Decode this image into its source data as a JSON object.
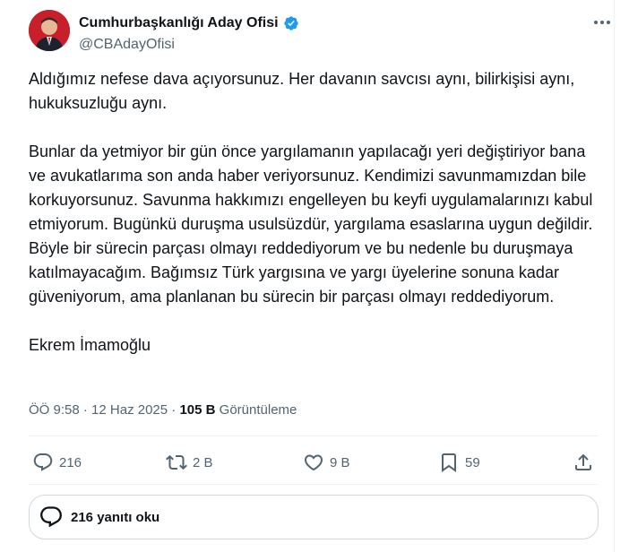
{
  "author": {
    "display_name": "Cumhurbaşkanlığı Aday Ofisi",
    "handle": "@CBAdayOfisi",
    "verified": true,
    "verified_color": "#1d9bf0"
  },
  "tweet": {
    "paragraphs": [
      "Aldığımız nefese dava açıyorsunuz. Her davanın savcısı aynı, bilirkişisi aynı,  hukuksuzluğu aynı.",
      "Bunlar da yetmiyor bir gün önce yargılamanın yapılacağı yeri değiştiriyor bana ve avukatlarıma son anda haber veriyorsunuz. Kendimizi savunmamızdan bile korkuyorsunuz. Savunma hakkımızı engelleyen bu keyfi uygulamalarınızı kabul etmiyorum. Bugünkü duruşma usulsüzdür, yargılama esaslarına uygun değildir. Böyle bir sürecin parçası olmayı reddediyorum ve bu nedenle bu duruşmaya katılmayacağım. Bağımsız Türk yargısına ve yargı üyelerine sonuna kadar güveniyorum, ama planlanan bu sürecin bir parçası olmayı reddediyorum.",
      "Ekrem İmamoğlu"
    ]
  },
  "meta": {
    "time": "ÖÖ 9:58",
    "separator": " · ",
    "date": "12 Haz 2025",
    "views_count": "105 B",
    "views_label": " Görüntüleme"
  },
  "actions": {
    "replies": "216",
    "reposts": "2 B",
    "likes": "9 B",
    "bookmarks": "59"
  },
  "read_replies_label": "216 yanıtı oku",
  "colors": {
    "text": "#0f1419",
    "secondary": "#536471",
    "border": "#cfd9de",
    "divider": "#eff3f4"
  }
}
